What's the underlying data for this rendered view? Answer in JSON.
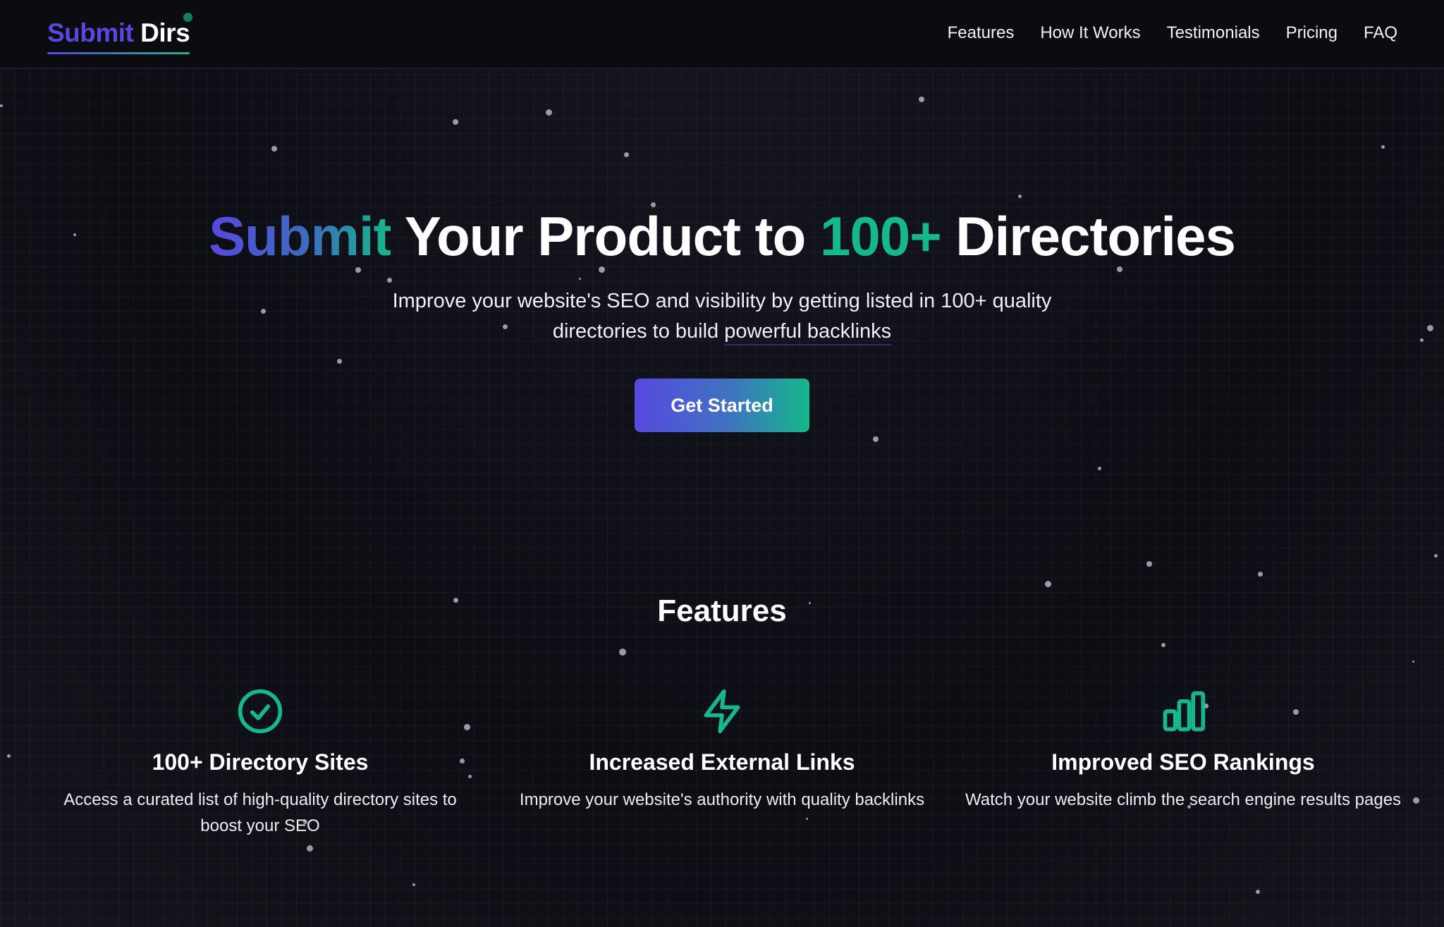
{
  "header": {
    "logo_part1": "Submit",
    "logo_part2": "Dirs",
    "nav": [
      "Features",
      "How It Works",
      "Testimonials",
      "Pricing",
      "FAQ"
    ]
  },
  "hero": {
    "title_part1": "Submit",
    "title_part2": " Your Product to ",
    "title_part3": "100+",
    "title_part4": " Directories",
    "subtitle_line1": "Improve your website's SEO and visibility by getting listed in 100+ quality",
    "subtitle_line2_start": "directories to build ",
    "subtitle_line2_highlight": "powerful backlinks",
    "cta_label": "Get Started"
  },
  "features": {
    "heading": "Features",
    "items": [
      {
        "icon": "check-circle-icon",
        "title": "100+ Directory Sites",
        "description": "Access a curated list of high-quality directory sites to boost your SEO"
      },
      {
        "icon": "lightning-bolt-icon",
        "title": "Increased External Links",
        "description": "Improve your website's authority with quality backlinks"
      },
      {
        "icon": "bar-chart-icon",
        "title": "Improved SEO Rankings",
        "description": "Watch your website climb the search engine results pages"
      }
    ]
  },
  "colors": {
    "brand_purple": "#5848e0",
    "brand_green": "#14b88a",
    "background": "#0d0d14"
  }
}
